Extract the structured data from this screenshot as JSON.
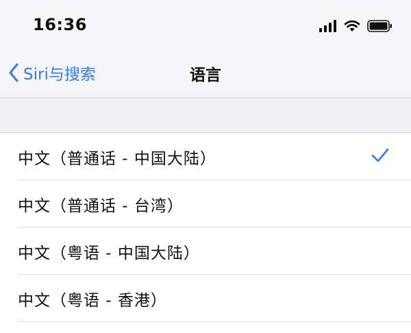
{
  "status_bar": {
    "time": "16:36",
    "icons": [
      "cellular-signal-icon",
      "wifi-icon",
      "battery-icon"
    ]
  },
  "nav": {
    "back_label": "Siri与搜索",
    "title": "语言"
  },
  "languages": [
    {
      "label": "中文（普通话 - 中国大陆）",
      "selected": true
    },
    {
      "label": "中文（普通话 - 台湾）",
      "selected": false
    },
    {
      "label": "中文（粤语 - 中国大陆）",
      "selected": false
    },
    {
      "label": "中文（粤语 - 香港）",
      "selected": false
    }
  ],
  "colors": {
    "accent": "#2f7bf6",
    "bar_background": "#f6f6f8",
    "grouped_background": "#efeff4"
  }
}
